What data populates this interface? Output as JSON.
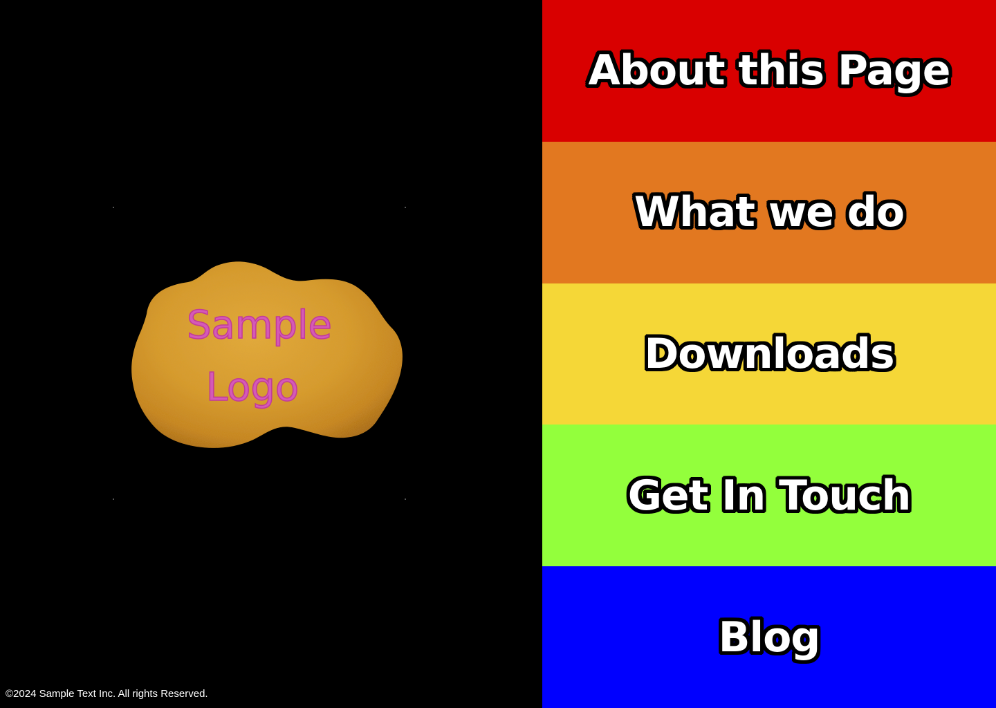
{
  "logo": {
    "line1": "Sample",
    "line2": "Logo",
    "image": "chicken-nugget-image",
    "text_color": "#d45ab7"
  },
  "footer": {
    "copyright": "©2024 Sample Text Inc. All rights Reserved."
  },
  "nav": {
    "items": [
      {
        "label": "About this Page",
        "color": "#d90000"
      },
      {
        "label": "What we do",
        "color": "#e27820"
      },
      {
        "label": "Downloads",
        "color": "#f5d737"
      },
      {
        "label": "Get In Touch",
        "color": "#93ff3c"
      },
      {
        "label": "Blog",
        "color": "#0000ff"
      }
    ]
  },
  "colors": {
    "background": "#000000"
  }
}
